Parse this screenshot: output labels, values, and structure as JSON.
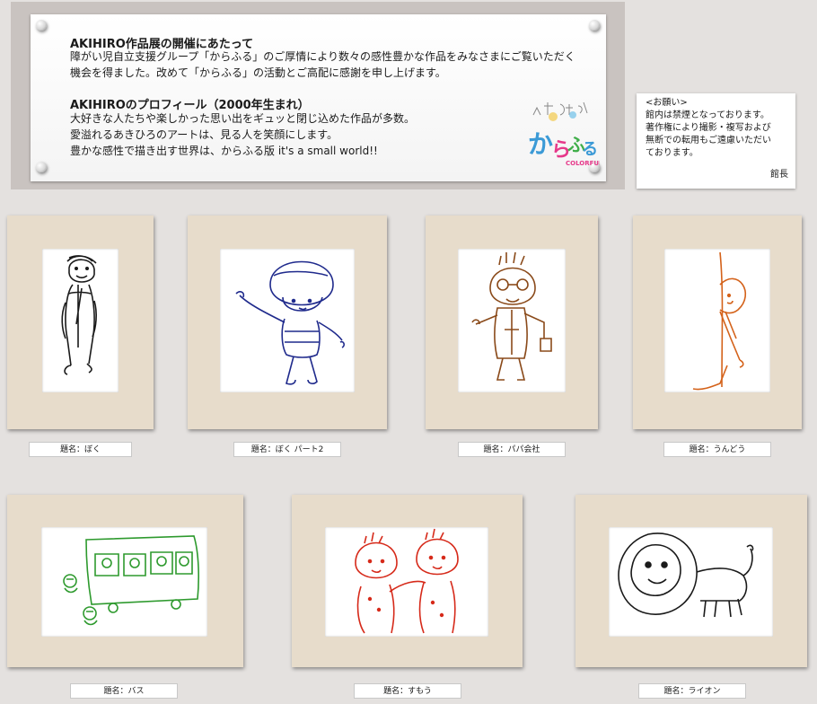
{
  "intro": {
    "heading1": "AKIHIRO作品展の開催にあたって",
    "para1": [
      "障がい児自立支援グループ「からふる」のご厚情により数々の感性豊かな作品をみなさまにご覧いただく",
      "機会を得ました。改めて「からふる」の活動とご高配に感謝を申し上げます。"
    ],
    "heading2": "AKIHIROのプロフィール（2000年生まれ）",
    "para2": [
      "大好きな人たちや楽しかった思い出をギュッと閉じ込めた作品が多数。",
      "愛溢れるあきひろのアートは、見る人を笑顔にします。",
      "豊かな感性で描き出す世界は、からふる版 it's a small world!!"
    ],
    "logo_text": "からふる",
    "logo_sub": "COLORFUL"
  },
  "notice": {
    "lines": [
      "<お願い>",
      "館内は禁煙となっております。",
      "著作権により撮影・複写および",
      "無断での転用もご遠慮いただい",
      "ております。"
    ],
    "signature": "館長"
  },
  "artworks": [
    {
      "title": "題名：ぼく",
      "ink": "#1a1a1a"
    },
    {
      "title": "題名：ぼく パート2",
      "ink": "#1f2a8c"
    },
    {
      "title": "題名：パパ会社",
      "ink": "#8a4a1a"
    },
    {
      "title": "題名：うんどう",
      "ink": "#d4621a"
    },
    {
      "title": "題名：バス",
      "ink": "#2e9a2e"
    },
    {
      "title": "題名：すもう",
      "ink": "#d62a1a"
    },
    {
      "title": "題名：ライオン",
      "ink": "#1a1a1a"
    }
  ],
  "colors": {
    "wall": "#e4e1df",
    "board": "#c9c3c0",
    "frame": "#e7dccb",
    "logo_blue": "#3b9ad6",
    "logo_pink": "#e6398a",
    "logo_green": "#3fae49"
  }
}
